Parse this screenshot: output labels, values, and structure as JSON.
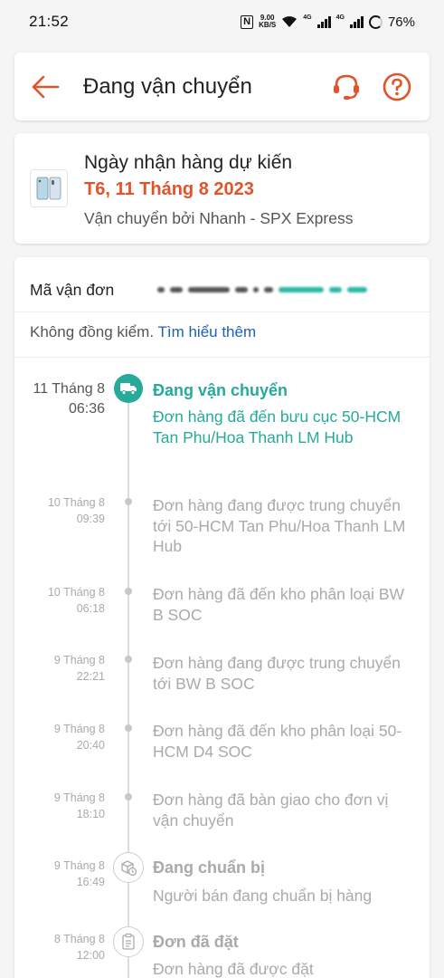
{
  "status_bar": {
    "time": "21:52",
    "nfc": "N",
    "net_speed_value": "9.00",
    "net_speed_unit": "KB/S",
    "sim1": "4G",
    "sim2": "4G",
    "battery": "76%"
  },
  "header": {
    "title": "Đang vận chuyển",
    "back_icon": "arrow-left-icon",
    "support_icon": "headset-icon",
    "help_icon": "question-circle-icon",
    "accent": "#e4522c"
  },
  "delivery": {
    "label": "Ngày nhận hàng dự kiến",
    "date": "T6, 11 Tháng 8 2023",
    "carrier": "Vận chuyển bởi Nhanh - SPX Express"
  },
  "tracking": {
    "waybill_label": "Mã vận đơn",
    "cocheck_text": "Không đồng kiểm.",
    "learn_more": "Tìm hiểu thêm",
    "events": [
      {
        "date": "11 Tháng 8",
        "time": "06:36",
        "title": "Đang vận chuyển",
        "desc": "Đơn hàng đã đến bưu cục 50-HCM Tan Phu/Hoa Thanh LM Hub",
        "icon": "truck-icon"
      },
      {
        "date": "10 Tháng 8",
        "time": "09:39",
        "desc": "Đơn hàng đang được trung chuyển  tới 50-HCM Tan Phu/Hoa Thanh LM Hub"
      },
      {
        "date": "10 Tháng 8",
        "time": "06:18",
        "desc": "Đơn hàng đã đến kho phân loại BW B SOC"
      },
      {
        "date": "9 Tháng 8",
        "time": "22:21",
        "desc": "Đơn hàng đang được trung chuyển  tới BW B SOC"
      },
      {
        "date": "9 Tháng 8",
        "time": "20:40",
        "desc": "Đơn hàng đã đến kho phân loại 50-HCM D4 SOC"
      },
      {
        "date": "9 Tháng 8",
        "time": "18:10",
        "desc": "Đơn hàng đã bàn giao cho đơn vị vận chuyển"
      },
      {
        "date": "9 Tháng 8",
        "time": "16:49",
        "title": "Đang chuẩn bị",
        "desc": "Người bán đang chuẩn bị hàng",
        "icon": "box-clock-icon"
      },
      {
        "date": "8 Tháng 8",
        "time": "12:00",
        "title": "Đơn đã đặt",
        "desc": "Đơn hàng đã được đặt",
        "icon": "clipboard-icon"
      }
    ],
    "active_color": "#26aa99",
    "link_color": "#1d5fb7"
  }
}
